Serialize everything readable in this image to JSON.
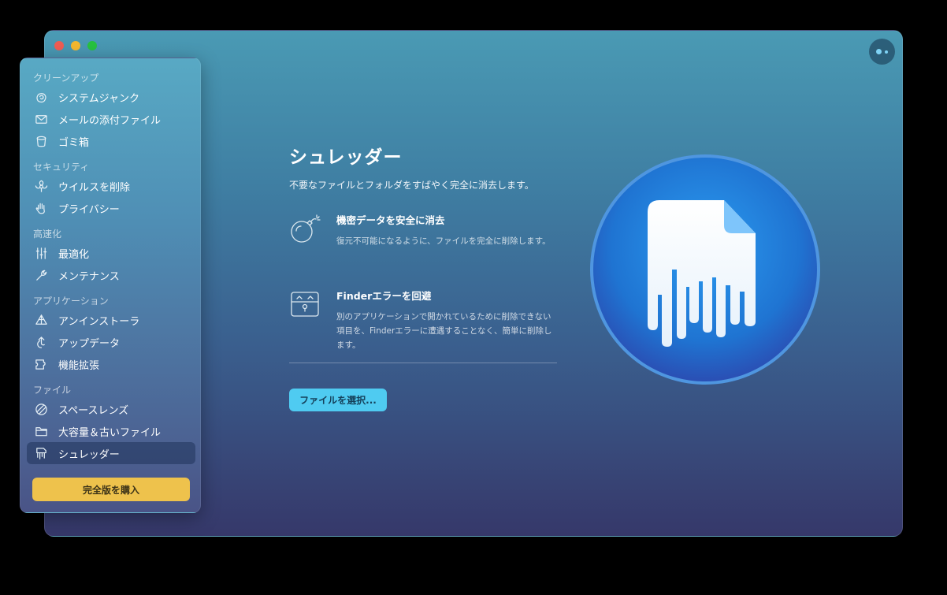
{
  "window": {
    "traffic_lights": [
      "close",
      "minimize",
      "zoom"
    ],
    "assistant_icon": "assistant-dots-icon"
  },
  "sidebar": {
    "sections": [
      {
        "title": "クリーンアップ",
        "items": [
          {
            "label": "システムジャンク",
            "icon": "system-junk-icon"
          },
          {
            "label": "メールの添付ファイル",
            "icon": "mail-icon"
          },
          {
            "label": "ゴミ箱",
            "icon": "trash-icon"
          }
        ]
      },
      {
        "title": "セキュリティ",
        "items": [
          {
            "label": "ウイルスを削除",
            "icon": "biohazard-icon"
          },
          {
            "label": "プライバシー",
            "icon": "hand-icon"
          }
        ]
      },
      {
        "title": "高速化",
        "items": [
          {
            "label": "最適化",
            "icon": "sliders-icon"
          },
          {
            "label": "メンテナンス",
            "icon": "wrench-icon"
          }
        ]
      },
      {
        "title": "アプリケーション",
        "items": [
          {
            "label": "アンインストーラ",
            "icon": "uninstaller-icon"
          },
          {
            "label": "アップデータ",
            "icon": "updater-icon"
          },
          {
            "label": "機能拡張",
            "icon": "extensions-icon"
          }
        ]
      },
      {
        "title": "ファイル",
        "items": [
          {
            "label": "スペースレンズ",
            "icon": "space-lens-icon"
          },
          {
            "label": "大容量＆古いファイル",
            "icon": "folder-icon"
          },
          {
            "label": "シュレッダー",
            "icon": "shredder-icon",
            "active": true
          }
        ]
      }
    ],
    "buy_label": "完全版を購入"
  },
  "main": {
    "title": "シュレッダー",
    "subtitle": "不要なファイルとフォルダをすばやく完全に消去します。",
    "features": [
      {
        "title": "機密データを安全に消去",
        "description": "復元不可能になるように、ファイルを完全に削除します。",
        "icon": "bomb-icon"
      },
      {
        "title": "Finderエラーを回避",
        "description": "別のアプリケーションで開かれているために削除できない項目を、Finderエラーに遭遇することなく、簡単に削除します。",
        "icon": "chest-icon"
      }
    ],
    "select_button": "ファイルを選択..."
  },
  "colors": {
    "accent": "#4fcbf1",
    "buy_button": "#eec24c",
    "hero_blue": "#1f7fd9"
  }
}
